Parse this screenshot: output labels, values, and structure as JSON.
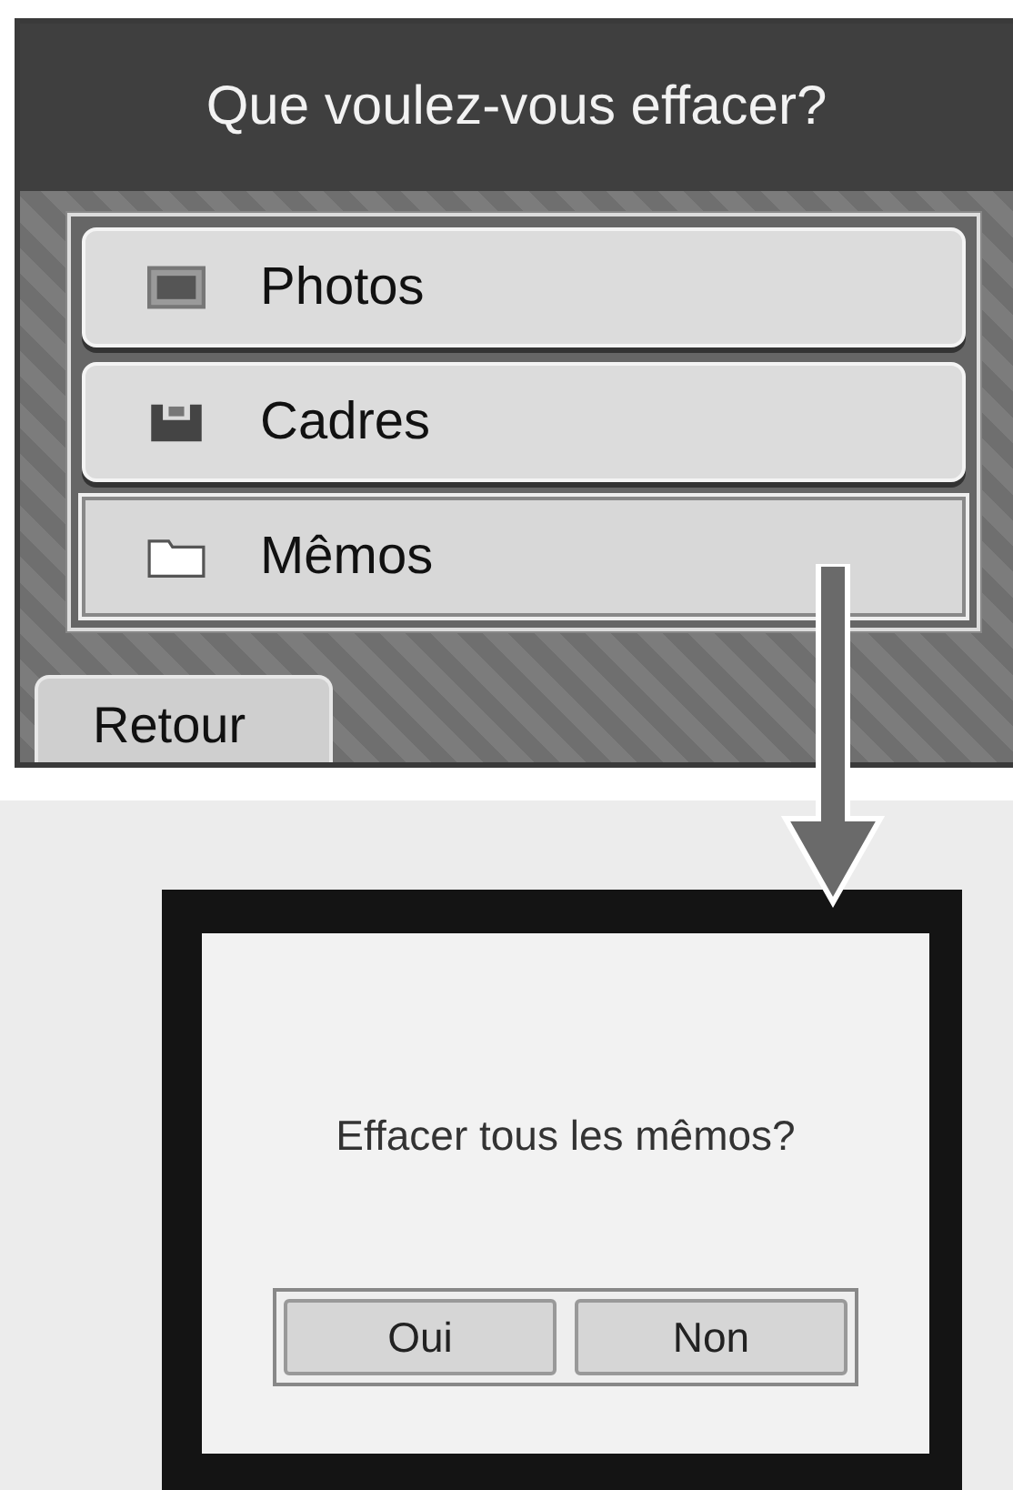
{
  "top_screen": {
    "title": "Que voulez-vous effacer?",
    "items": [
      {
        "kind": "photo",
        "label": "Photos",
        "selected": false
      },
      {
        "kind": "frame",
        "label": "Cadres",
        "selected": false
      },
      {
        "kind": "folder",
        "label": "Mêmos",
        "selected": true
      }
    ],
    "back_button": "Retour"
  },
  "dialog": {
    "message": "Effacer tous les mêmos?",
    "buttons": [
      "Oui",
      "Non"
    ]
  }
}
